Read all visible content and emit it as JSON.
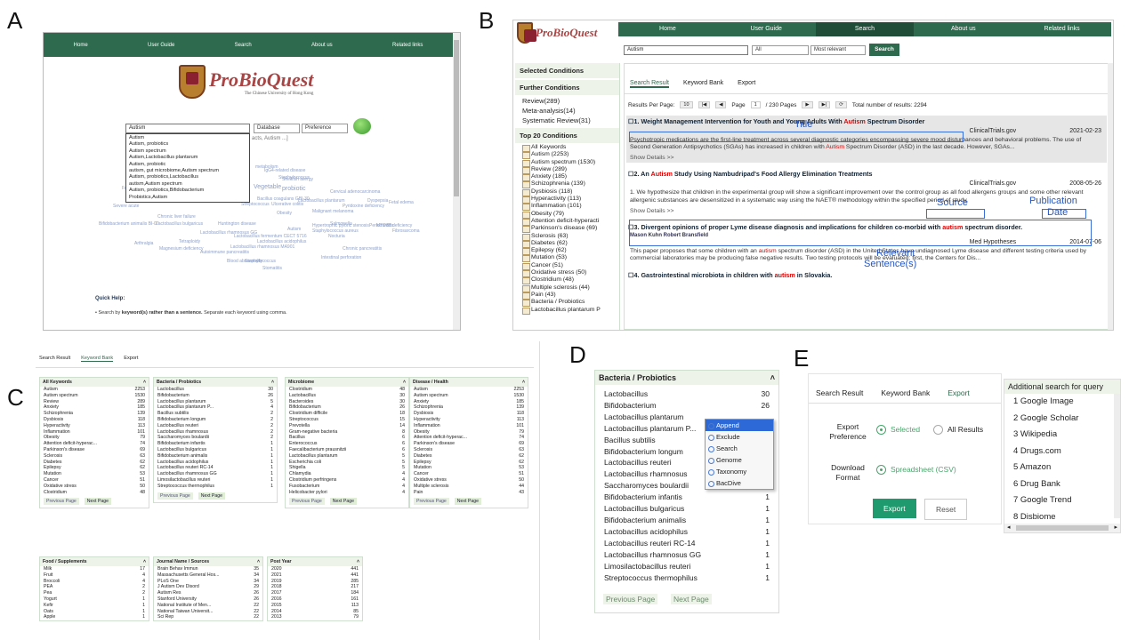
{
  "labels": {
    "a": "A",
    "b": "B",
    "c": "C",
    "d": "D",
    "e": "E"
  },
  "panelA": {
    "nav": [
      "Home",
      "User Guide",
      "Search",
      "About us",
      "Related links"
    ],
    "brand": "ProBioQuest",
    "brand_sub": "The Chinese University of Hong Kong",
    "search_value": "Autism",
    "select1": "Database",
    "select2": "Preference",
    "hint_fragment": "acts, Autism ...]",
    "suggestions": [
      "Autism",
      "Autism, probiotics",
      "Autism spectrum",
      "Autism,Lactobacillus plantarum",
      "Autism, probiotic",
      "autism, gut microbiome,Autism spectrum",
      "Autism, probiotics,Lactobacillus",
      "autism,Autism spectrum",
      "Autism, probiotics,Bifidobacterium",
      "Probiotics,Autism"
    ],
    "cloud": [
      "metabolism",
      "Vegetable",
      "probiotic",
      "Lactobacillus plantarum",
      "Cervical adenocarcinoma",
      "Malignant melanoma",
      "Dyspepsia",
      "Fetal edema",
      "Salmonella",
      "Periodontitis",
      "Staphylococcus aureus",
      "Fibrosarcoma",
      "Autism",
      "Nocturia",
      "Chronic pancreatitis",
      "Stomatitis",
      "Intestinal perforation",
      "Blood abnormality",
      "Magnesium deficiency",
      "Arthralgia",
      "Tetraploidy",
      "Lactobacillus acidophilus",
      "Autoimmune pancreatitis",
      "Staphylococcus",
      "Lactobacillus rhamnosus GG",
      "Severe acute",
      "Bifidobacterium animalis BI-07",
      "Lactobacillus bulgaricus",
      "Huntington disease",
      "Obesity",
      "Shellfish allergy",
      "Pyridoxine deficiency",
      "IgG4-related disease",
      "Lactobacillus fermentum CECT 5716",
      "Ulcerative colitis",
      "Chronic liver failure",
      "Hypertrophic pyloric stenosis",
      "MYD88 deficiency",
      "Lactobacillus rhamnosus MA901",
      "Streptococcus",
      "Bacillus coagulans GBI-30",
      "Folic",
      "Staphylococcus"
    ],
    "quick_help": "Quick Help:",
    "help_prefix": "Search by ",
    "help_bold": "keyword(s) rather than a sentence.",
    "help_suffix": " Separate each keyword using comma."
  },
  "panelB": {
    "nav": [
      "Home",
      "User Guide",
      "Search",
      "About us",
      "Related links"
    ],
    "brand": "ProBioQuest",
    "search_value": "Autism",
    "select1": "All",
    "select2": "Most relevant",
    "search_btn": "Search",
    "selected_conditions": "Selected Conditions",
    "further_conditions": "Further Conditions",
    "further": [
      "Review(289)",
      "Meta-analysis(14)",
      "Systematic Review(31)"
    ],
    "top20": "Top 20 Conditions",
    "all_keywords": "All Keywords",
    "keywords": [
      "Autism (2253)",
      "Autism spectrum (1530)",
      "Review (289)",
      "Anxiety (185)",
      "Schizophrenia (139)",
      "Dysbiosis (118)",
      "Hyperactivity (113)",
      "Inflammation (101)",
      "Obesity (79)",
      "Attention deficit-hyperacti",
      "Parkinson's disease (69)",
      "Sclerosis (63)",
      "Diabetes (62)",
      "Epilepsy (62)",
      "Mutation (53)",
      "Cancer (51)",
      "Oxidative stress (50)",
      "Clostridium (48)",
      "Multiple sclerosis (44)",
      "Pain (43)"
    ],
    "bacteria_folder": "Bacteria / Probiotics",
    "bacteria_first": "Lactobacillus plantarum P",
    "tabs": [
      "Search Result",
      "Keyword Bank",
      "Export"
    ],
    "per_page_label": "Results Per Page:",
    "per_page": "10",
    "page_label": "Page",
    "page_value": "1",
    "pages_total": "/ 230 Pages",
    "total": "Total number of results: 2294",
    "results": [
      {
        "num": "1. ",
        "pre": "Weight Management Intervention for Youth and Young Adults With ",
        "hl": "Autism",
        "post": " Spectrum Disorder",
        "source": "ClinicalTrials.gov",
        "date": "2021-02-23",
        "body_pre": "Psychotropic medications are the first-line treatment across several diagnostic categories encompassing severe mood disturbances and behavioral problems. The use of Second Generation Antipsychotics (SGAs) has increased in children with ",
        "body_hl": "Autism",
        "body_post": " Spectrum Disorder (ASD) in the last decade. However, SGAs...",
        "show": "Show Details >>"
      },
      {
        "num": "2. An ",
        "pre": "",
        "hl": "Autism",
        "post": " Study Using Nambudripad's Food Allergy Elimination Treatments",
        "source": "ClinicalTrials.gov",
        "date": "2008-05-26",
        "body_pre": "1. We hypothesize that children in the experimental group will show a significant improvement over the control group as all food allergens groups and some other relevant allergenic substances are desensitized in a systematic way using the NAET® methodology within the specified period of study.",
        "body_hl": "",
        "body_post": "",
        "show": "Show Details >>"
      },
      {
        "num": "3. ",
        "pre": "Divergent opinions of proper Lyme disease diagnosis and implications for children co-morbid with ",
        "hl": "autism",
        "post": " spectrum disorder.",
        "authors": "Mason Kuhn   Robert Bransfield",
        "source": "Med Hypotheses",
        "date": "2014-07-06",
        "body_pre": "This paper proposes that some children with an ",
        "body_hl": "autism",
        "body_post": " spectrum disorder (ASD) in the United States have undiagnosed Lyme disease and different testing criteria used by commercial laboratories may be producing false negative results. Two testing protocols will be evaluated; first, the Centers for Dis..."
      },
      {
        "num": "4. ",
        "pre": "Gastrointestinal microbiota in children with ",
        "hl": "autism",
        "post": " in Slovakia."
      }
    ],
    "ann": {
      "title": "Title",
      "source": "Source",
      "publication": "Publication",
      "date_word": "Date",
      "relevant": "Relevant",
      "sentences": "Sentence(s)"
    }
  },
  "panelC": {
    "tabs": [
      "Search Result",
      "Keyword Bank",
      "Export"
    ],
    "prev": "Previous Page",
    "next": "Next Page",
    "boxes": [
      {
        "title": "All Keywords",
        "rows": [
          [
            "Autism",
            "2253"
          ],
          [
            "Autism spectrum",
            "1530"
          ],
          [
            "Review",
            "289"
          ],
          [
            "Anxiety",
            "185"
          ],
          [
            "Schizophrenia",
            "139"
          ],
          [
            "Dysbiosis",
            "118"
          ],
          [
            "Hyperactivity",
            "113"
          ],
          [
            "Inflammation",
            "101"
          ],
          [
            "Obesity",
            "79"
          ],
          [
            "Attention deficit-hyperac...",
            "74"
          ],
          [
            "Parkinson's disease",
            "69"
          ],
          [
            "Sclerosis",
            "63"
          ],
          [
            "Diabetes",
            "62"
          ],
          [
            "Epilepsy",
            "62"
          ],
          [
            "Mutation",
            "53"
          ],
          [
            "Cancer",
            "51"
          ],
          [
            "Oxidative stress",
            "50"
          ],
          [
            "Clostridium",
            "48"
          ]
        ]
      },
      {
        "title": "Bacteria / Probiotics",
        "rows": [
          [
            "Lactobacillus",
            "30"
          ],
          [
            "Bifidobacterium",
            "26"
          ],
          [
            "Lactobacillus plantarum",
            "5"
          ],
          [
            "Lactobacillus plantarum P...",
            "4"
          ],
          [
            "Bacillus subtilis",
            "2"
          ],
          [
            "Bifidobacterium longum",
            "2"
          ],
          [
            "Lactobacillus reuteri",
            "2"
          ],
          [
            "Lactobacillus rhamnosus",
            "2"
          ],
          [
            "Saccharomyces boulardii",
            "2"
          ],
          [
            "Bifidobacterium infantis",
            "1"
          ],
          [
            "Lactobacillus bulgaricus",
            "1"
          ],
          [
            "Bifidobacterium animalis",
            "1"
          ],
          [
            "Lactobacillus acidophilus",
            "1"
          ],
          [
            "Lactobacillus reuteri RC-14",
            "1"
          ],
          [
            "Lactobacillus rhamnosus GG",
            "1"
          ],
          [
            "Limosilactobacillus reuteri",
            "1"
          ],
          [
            "Streptococcus thermophilus",
            "1"
          ]
        ]
      },
      {
        "title": "Microbiome",
        "rows": [
          [
            "Clostridium",
            "48"
          ],
          [
            "Lactobacillus",
            "30"
          ],
          [
            "Bacteroides",
            "30"
          ],
          [
            "Bifidobacterium",
            "26"
          ],
          [
            "Clostridium difficile",
            "18"
          ],
          [
            "Streptococcus",
            "15"
          ],
          [
            "Prevotella",
            "14"
          ],
          [
            "Gram-negative bacteria",
            "8"
          ],
          [
            "Bacillus",
            "6"
          ],
          [
            "Enterococcus",
            "6"
          ],
          [
            "Faecalibacterium prausnitzii",
            "6"
          ],
          [
            "Lactobacillus plantarum",
            "5"
          ],
          [
            "Escherichia coli",
            "5"
          ],
          [
            "Shigella",
            "5"
          ],
          [
            "Chlamydia",
            "4"
          ],
          [
            "Clostridium perfringens",
            "4"
          ],
          [
            "Fusobacterium",
            "4"
          ],
          [
            "Helicobacter pylori",
            "4"
          ]
        ]
      },
      {
        "title": "Disease / Health",
        "rows": [
          [
            "Autism",
            "2253"
          ],
          [
            "Autism spectrum",
            "1530"
          ],
          [
            "Anxiety",
            "185"
          ],
          [
            "Schizophrenia",
            "139"
          ],
          [
            "Dysbiosis",
            "118"
          ],
          [
            "Hyperactivity",
            "113"
          ],
          [
            "Inflammation",
            "101"
          ],
          [
            "Obesity",
            "79"
          ],
          [
            "Attention deficit-hyperac...",
            "74"
          ],
          [
            "Parkinson's disease",
            "69"
          ],
          [
            "Sclerosis",
            "63"
          ],
          [
            "Diabetes",
            "62"
          ],
          [
            "Epilepsy",
            "62"
          ],
          [
            "Mutation",
            "53"
          ],
          [
            "Cancer",
            "51"
          ],
          [
            "Oxidative stress",
            "50"
          ],
          [
            "Multiple sclerosis",
            "44"
          ],
          [
            "Pain",
            "43"
          ]
        ]
      },
      {
        "title": "Food / Supplements",
        "rows": [
          [
            "Milk",
            "17"
          ],
          [
            "Fruit",
            "4"
          ],
          [
            "Broccoli",
            "4"
          ],
          [
            "PEA",
            "2"
          ],
          [
            "Pea",
            "2"
          ],
          [
            "Yogurt",
            "1"
          ],
          [
            "Kefir",
            "1"
          ],
          [
            "Oats",
            "1"
          ],
          [
            "Apple",
            "1"
          ]
        ]
      },
      {
        "title": "Journal Name / Sources",
        "rows": [
          [
            "Brain Behav Immun",
            "35"
          ],
          [
            "Massachusetts General Hos...",
            "34"
          ],
          [
            "PLoS One",
            "34"
          ],
          [
            "J Autism Dev Disord",
            "29"
          ],
          [
            "Autism Res",
            "26"
          ],
          [
            "Stanford University",
            "26"
          ],
          [
            "National Institute of Men...",
            "22"
          ],
          [
            "National Taiwan Universit...",
            "22"
          ],
          [
            "Sci Rep",
            "22"
          ]
        ]
      },
      {
        "title": "Post Year",
        "rows": [
          [
            "2020",
            "441"
          ],
          [
            "2021",
            "441"
          ],
          [
            "2019",
            "285"
          ],
          [
            "2018",
            "217"
          ],
          [
            "2017",
            "184"
          ],
          [
            "2016",
            "161"
          ],
          [
            "2015",
            "113"
          ],
          [
            "2014",
            "85"
          ],
          [
            "2013",
            "79"
          ]
        ]
      }
    ]
  },
  "panelD": {
    "title": "Bacteria / Probiotics",
    "rows": [
      [
        "Lactobacillus",
        "30"
      ],
      [
        "Bifidobacterium",
        "26"
      ],
      [
        "Lactobacillus plantarum",
        ""
      ],
      [
        "Lactobacillus plantarum P...",
        ""
      ],
      [
        "Bacillus subtilis",
        ""
      ],
      [
        "Bifidobacterium longum",
        ""
      ],
      [
        "Lactobacillus reuteri",
        ""
      ],
      [
        "Lactobacillus rhamnosus",
        ""
      ],
      [
        "Saccharomyces boulardii",
        ""
      ],
      [
        "Bifidobacterium infantis",
        "1"
      ],
      [
        "Lactobacillus bulgaricus",
        "1"
      ],
      [
        "Bifidobacterium animalis",
        "1"
      ],
      [
        "Lactobacillus acidophilus",
        "1"
      ],
      [
        "Lactobacillus reuteri RC-14",
        "1"
      ],
      [
        "Lactobacillus rhamnosus GG",
        "1"
      ],
      [
        "Limosilactobacillus reuteri",
        "1"
      ],
      [
        "Streptococcus thermophilus",
        "1"
      ]
    ],
    "menu": [
      "Append",
      "Exclude",
      "Search",
      "Genome",
      "Taxonomy",
      "BacDive"
    ],
    "prev": "Previous Page",
    "next": "Next Page"
  },
  "panelE": {
    "tabs": [
      "Search Result",
      "Keyword Bank",
      "Export"
    ],
    "export_pref": "Export\nPreference",
    "selected": "Selected",
    "all_results": "All Results",
    "download_format": "Download\nFormat",
    "spreadsheet": "Spreadsheet (CSV)",
    "export_btn": "Export",
    "reset_btn": "Reset",
    "side_title": "Additional search for query",
    "side_items": [
      "1 Google Image",
      "2 Google Scholar",
      "3 Wikipedia",
      "4 Drugs.com",
      "5 Amazon",
      "6 Drug Bank",
      "7 Google Trend",
      "8 Disbiome"
    ]
  }
}
